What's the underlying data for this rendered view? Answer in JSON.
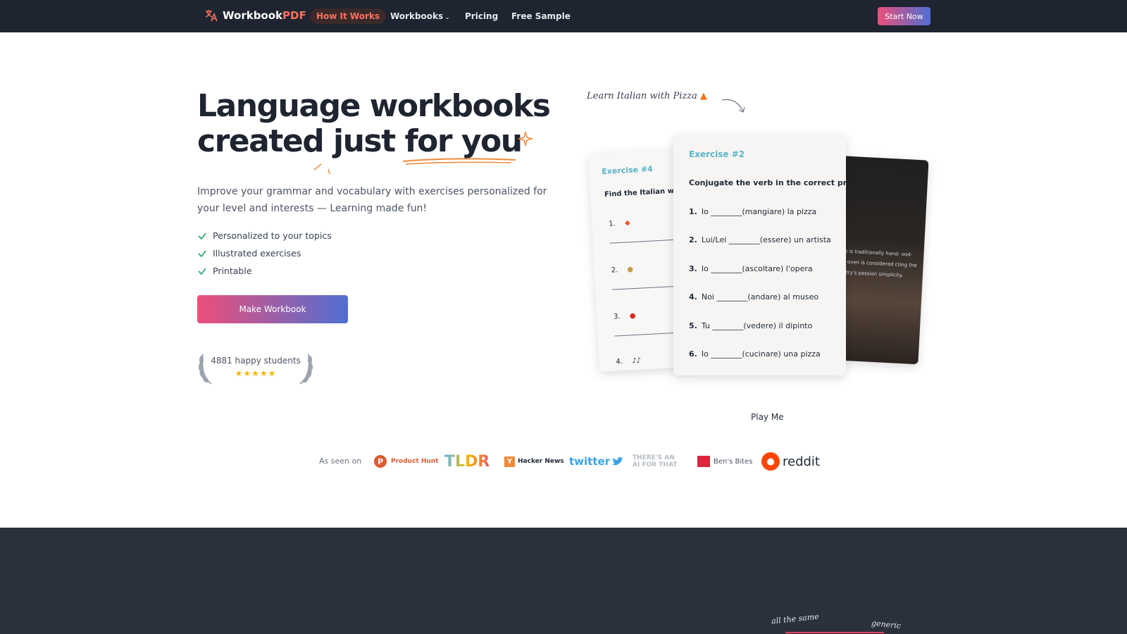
{
  "nav": {
    "brand_main": "Workbook",
    "brand_accent": "PDF",
    "links": [
      {
        "label": "How It Works"
      },
      {
        "label": "Workbooks"
      },
      {
        "label": "Pricing"
      },
      {
        "label": "Free Sample"
      }
    ],
    "cta": "Start Now"
  },
  "hero": {
    "title_line1": "Language workbooks",
    "title_line2": "created just for you",
    "subtitle": "Improve your grammar and vocabulary with exercises personalized for your level and interests — Learning made fun!",
    "features": [
      "Personalized to your topics",
      "Illustrated exercises",
      "Printable"
    ],
    "button": "Make Workbook",
    "students": "4881 happy students",
    "stars": "★★★★★",
    "rating": 5
  },
  "preview": {
    "handnote": "Learn Italian with Pizza",
    "card_left": {
      "title": "Exercise #4",
      "instruction": "Find the Italian word",
      "items": [
        "1.",
        "2.",
        "3.",
        "4."
      ]
    },
    "card_mid": {
      "title": "Exercise #2",
      "instruction": "Conjugate the verb in the correct present t",
      "questions": [
        {
          "num": "1.",
          "text": "Io ________(mangiare) la pizza"
        },
        {
          "num": "2.",
          "text": "Lui/Lei ________(essere) un artista"
        },
        {
          "num": "3.",
          "text": "Io ________(ascoltare) l'opera"
        },
        {
          "num": "4.",
          "text": "Noi ________(andare) al museo"
        },
        {
          "num": "5.",
          "text": "Tu ________(vedere) il dipinto"
        },
        {
          "num": "6.",
          "text": "Io ________(cucinare) una pizza"
        }
      ]
    },
    "card_right": {
      "text": "ough is traditionally hand- ood-fired oven is considered cting the country's passion simplicity."
    },
    "play": "Play Me"
  },
  "as_seen_on": {
    "label": "As seen on",
    "brands": {
      "producthunt": "Product Hunt",
      "producthunt_letter": "P",
      "tldr": "TLDR",
      "hackernews": "Hacker News",
      "hackernews_letter": "Y",
      "twitter": "twitter",
      "aift_line1": "THERE'S AN",
      "aift_line2": "AI FOR THAT",
      "bensbites": "Ben's Bites",
      "reddit": "reddit"
    }
  },
  "dark_section": {
    "scribble1": "all the same",
    "scribble2": "generic"
  },
  "colors": {
    "nav_bg": "#1e2430",
    "accent": "#f97360",
    "gradient_start": "#ec4f7a",
    "gradient_end": "#4f6fd1",
    "check": "#22a366",
    "exercise_title": "#5ab4c9",
    "dark_section": "#2a303c"
  }
}
